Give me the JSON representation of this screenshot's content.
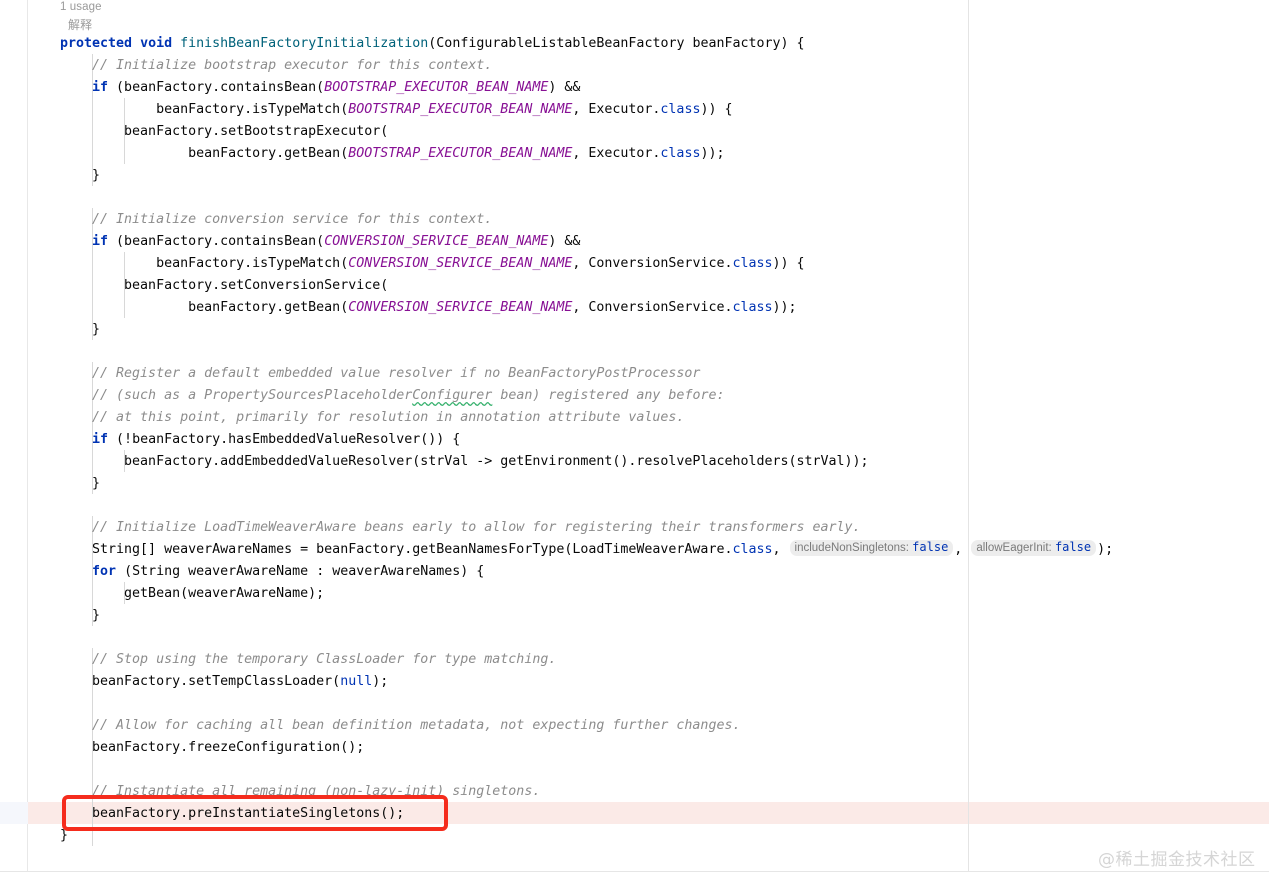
{
  "editor": {
    "inlay_usages": "1 usage",
    "inlay_explain": "解释",
    "hint_include_non_singletons_label": "includeNonSingletons:",
    "hint_include_non_singletons_value": "false",
    "hint_allow_eager_init_label": "allowEagerInit:",
    "hint_allow_eager_init_value": "false",
    "watermark": "@稀土掘金技术社区",
    "colors": {
      "keyword": "#0033b3",
      "method": "#00627a",
      "comment": "#8c8c8c",
      "constant": "#871094",
      "text": "#080808",
      "highlight_line": "#fbeae7",
      "gutter_highlight": "#f5f7fc",
      "annotation_border": "#f52c1d",
      "divider": "#e4e4e4",
      "watermark": "#d5d5d5",
      "spellcheck_squiggle": "#3cb371"
    },
    "lines": {
      "l01": "protected void finishBeanFactoryInitialization(ConfigurableListableBeanFactory beanFactory) {",
      "l02": "// Initialize bootstrap executor for this context.",
      "l03": "if (beanFactory.containsBean(BOOTSTRAP_EXECUTOR_BEAN_NAME) &&",
      "l04": "beanFactory.isTypeMatch(BOOTSTRAP_EXECUTOR_BEAN_NAME, Executor.class)) {",
      "l05": "beanFactory.setBootstrapExecutor(",
      "l06": "beanFactory.getBean(BOOTSTRAP_EXECUTOR_BEAN_NAME, Executor.class));",
      "l07": "}",
      "l08": "// Initialize conversion service for this context.",
      "l09": "if (beanFactory.containsBean(CONVERSION_SERVICE_BEAN_NAME) &&",
      "l10": "beanFactory.isTypeMatch(CONVERSION_SERVICE_BEAN_NAME, ConversionService.class)) {",
      "l11": "beanFactory.setConversionService(",
      "l12": "beanFactory.getBean(CONVERSION_SERVICE_BEAN_NAME, ConversionService.class));",
      "l13": "}",
      "l14": "// Register a default embedded value resolver if no BeanFactoryPostProcessor",
      "l15": "// (such as a PropertySourcesPlaceholderConfigurer bean) registered any before:",
      "l16": "// at this point, primarily for resolution in annotation attribute values.",
      "l17": "if (!beanFactory.hasEmbeddedValueResolver()) {",
      "l18": "beanFactory.addEmbeddedValueResolver(strVal -> getEnvironment().resolvePlaceholders(strVal));",
      "l19": "}",
      "l20": "// Initialize LoadTimeWeaverAware beans early to allow for registering their transformers early.",
      "l21": "String[] weaverAwareNames = beanFactory.getBeanNamesForType(LoadTimeWeaverAware.class,",
      "l22": "for (String weaverAwareName : weaverAwareNames) {",
      "l23": "getBean(weaverAwareName);",
      "l24": "}",
      "l25": "// Stop using the temporary ClassLoader for type matching.",
      "l26": "beanFactory.setTempClassLoader(null);",
      "l27": "// Allow for caching all bean definition metadata, not expecting further changes.",
      "l28": "beanFactory.freezeConfiguration();",
      "l29": "// Instantiate all remaining (non-lazy-init) singletons.",
      "l30": "beanFactory.preInstantiateSingletons();",
      "l31": "}"
    },
    "tokens": {
      "kw_protected": "protected",
      "kw_void": "void",
      "kw_if": "if",
      "kw_for": "for",
      "kw_class": "class",
      "kw_null": "null",
      "method_name": "finishBeanFactoryInitialization",
      "const_bootstrap": "BOOTSTRAP_EXECUTOR_BEAN_NAME",
      "const_conversion": "CONVERSION_SERVICE_BEAN_NAME",
      "spell_word": "Configurer"
    }
  }
}
